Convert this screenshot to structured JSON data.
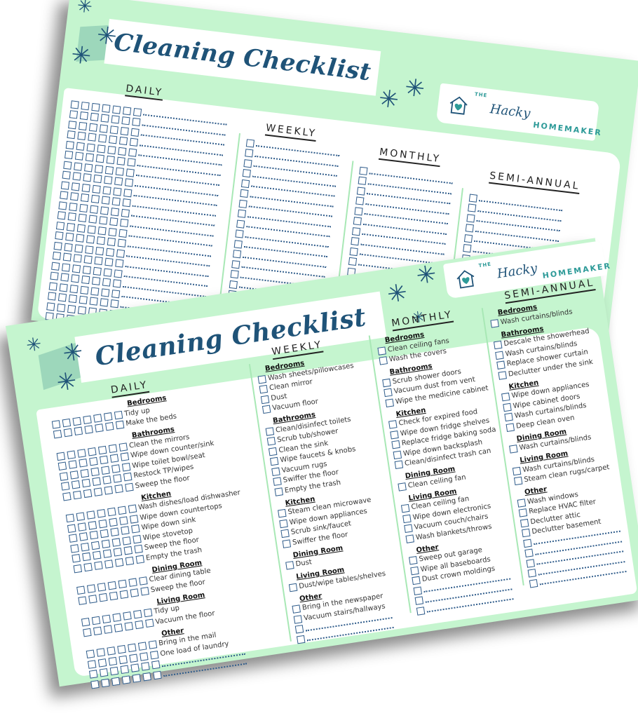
{
  "brand": {
    "the": "THE",
    "hacky": "Hacky",
    "homemaker": "HOMEMAKER",
    "icon": "house-heart-icon",
    "accent": "#2d9a98",
    "navy": "#1f5378"
  },
  "colors": {
    "sheet_bg": "#c5f5cf",
    "checkbox": "#2e5b8a",
    "ribbon": "#9dd7bb"
  },
  "back_sheet": {
    "title": "Cleaning Checklist",
    "columns": [
      {
        "heading": "DAILY",
        "blank_rows": 22,
        "boxes_per_row": 7
      },
      {
        "heading": "WEEKLY",
        "blank_rows": 18,
        "boxes_per_row": 1
      },
      {
        "heading": "MONTHLY",
        "blank_rows": 16,
        "boxes_per_row": 1
      },
      {
        "heading": "SEMI-ANNUAL",
        "blank_rows": 9,
        "boxes_per_row": 1
      }
    ]
  },
  "front_sheet": {
    "title": "Cleaning Checklist",
    "columns": [
      {
        "heading": "DAILY",
        "boxes_per_row": 7,
        "sections": [
          {
            "name": "Bedrooms",
            "items": [
              "Tidy up",
              "Make the beds"
            ]
          },
          {
            "name": "Bathrooms",
            "items": [
              "Clean the mirrors",
              "Wipe down counter/sink",
              "Wipe toilet bowl/seat",
              "Restock TP/wipes",
              "Sweep the floor"
            ]
          },
          {
            "name": "Kitchen",
            "items": [
              "Wash dishes/load dishwasher",
              "Wipe down countertops",
              "Wipe down sink",
              "Wipe stovetop",
              "Sweep the floor",
              "Empty the trash"
            ]
          },
          {
            "name": "Dining Room",
            "items": [
              "Clear dining table",
              "Sweep the floor"
            ]
          },
          {
            "name": "Living Room",
            "items": [
              "Tidy up",
              "Vacuum the floor"
            ]
          },
          {
            "name": "Other",
            "items": [
              "Bring in the mail",
              "One load of laundry",
              "",
              ""
            ]
          }
        ]
      },
      {
        "heading": "WEEKLY",
        "boxes_per_row": 1,
        "sections": [
          {
            "name": "Bedrooms",
            "items": [
              "Wash sheets/pillowcases",
              "Clean mirror",
              "Dust",
              "Vacuum floor"
            ]
          },
          {
            "name": "Bathrooms",
            "items": [
              "Clean/disinfect toilets",
              "Scrub tub/shower",
              "Clean the sink",
              "Wipe faucets & knobs",
              "Vacuum rugs",
              "Swiffer the floor",
              "Empty the trash"
            ]
          },
          {
            "name": "Kitchen",
            "items": [
              "Steam clean microwave",
              "Wipe down appliances",
              "Scrub sink/faucet",
              "Swiffer the floor"
            ]
          },
          {
            "name": "Dining Room",
            "items": [
              "Dust"
            ]
          },
          {
            "name": "Living Room",
            "items": [
              "Dust/wipe tables/shelves"
            ]
          },
          {
            "name": "Other",
            "items": [
              "Bring in the newspaper",
              "Vacuum stairs/hallways",
              "",
              ""
            ]
          }
        ]
      },
      {
        "heading": "MONTHLY",
        "boxes_per_row": 1,
        "sections": [
          {
            "name": "Bedrooms",
            "items": [
              "Clean ceiling fans",
              "Wash the covers"
            ]
          },
          {
            "name": "Bathrooms",
            "items": [
              "Scrub shower doors",
              "Vacuum dust from vent",
              "Wipe the medicine cabinet"
            ]
          },
          {
            "name": "Kitchen",
            "items": [
              "Check for expired food",
              "Wipe down fridge shelves",
              "Replace fridge baking soda",
              "Wipe down backsplash",
              "Clean/disinfect trash can"
            ]
          },
          {
            "name": "Dining Room",
            "items": [
              "Clean ceiling fan"
            ]
          },
          {
            "name": "Living Room",
            "items": [
              "Clean ceiling fan",
              "Wipe down electronics",
              "Vacuum couch/chairs",
              "Wash blankets/throws"
            ]
          },
          {
            "name": "Other",
            "items": [
              "Sweep out garage",
              "Wipe all baseboards",
              "Dust crown moldings",
              "",
              "",
              ""
            ]
          }
        ]
      },
      {
        "heading": "SEMI-ANNUAL",
        "boxes_per_row": 1,
        "sections": [
          {
            "name": "Bedrooms",
            "items": [
              "Wash curtains/blinds"
            ]
          },
          {
            "name": "Bathrooms",
            "items": [
              "Descale the showerhead",
              "Wash curtains/blinds",
              "Replace shower curtain",
              "Declutter under the sink"
            ]
          },
          {
            "name": "Kitchen",
            "items": [
              "Wipe down appliances",
              "Wipe cabinet doors",
              "Wash curtains/blinds",
              "Deep clean oven"
            ]
          },
          {
            "name": "Dining Room",
            "items": [
              "Wash curtains/blinds"
            ]
          },
          {
            "name": "Living Room",
            "items": [
              "Wash curtains/blinds",
              "Steam clean rugs/carpet"
            ]
          },
          {
            "name": "Other",
            "items": [
              "Wash windows",
              "Replace HVAC filter",
              "Declutter attic",
              "Declutter basement",
              "",
              "",
              "",
              "",
              ""
            ]
          }
        ]
      }
    ]
  }
}
